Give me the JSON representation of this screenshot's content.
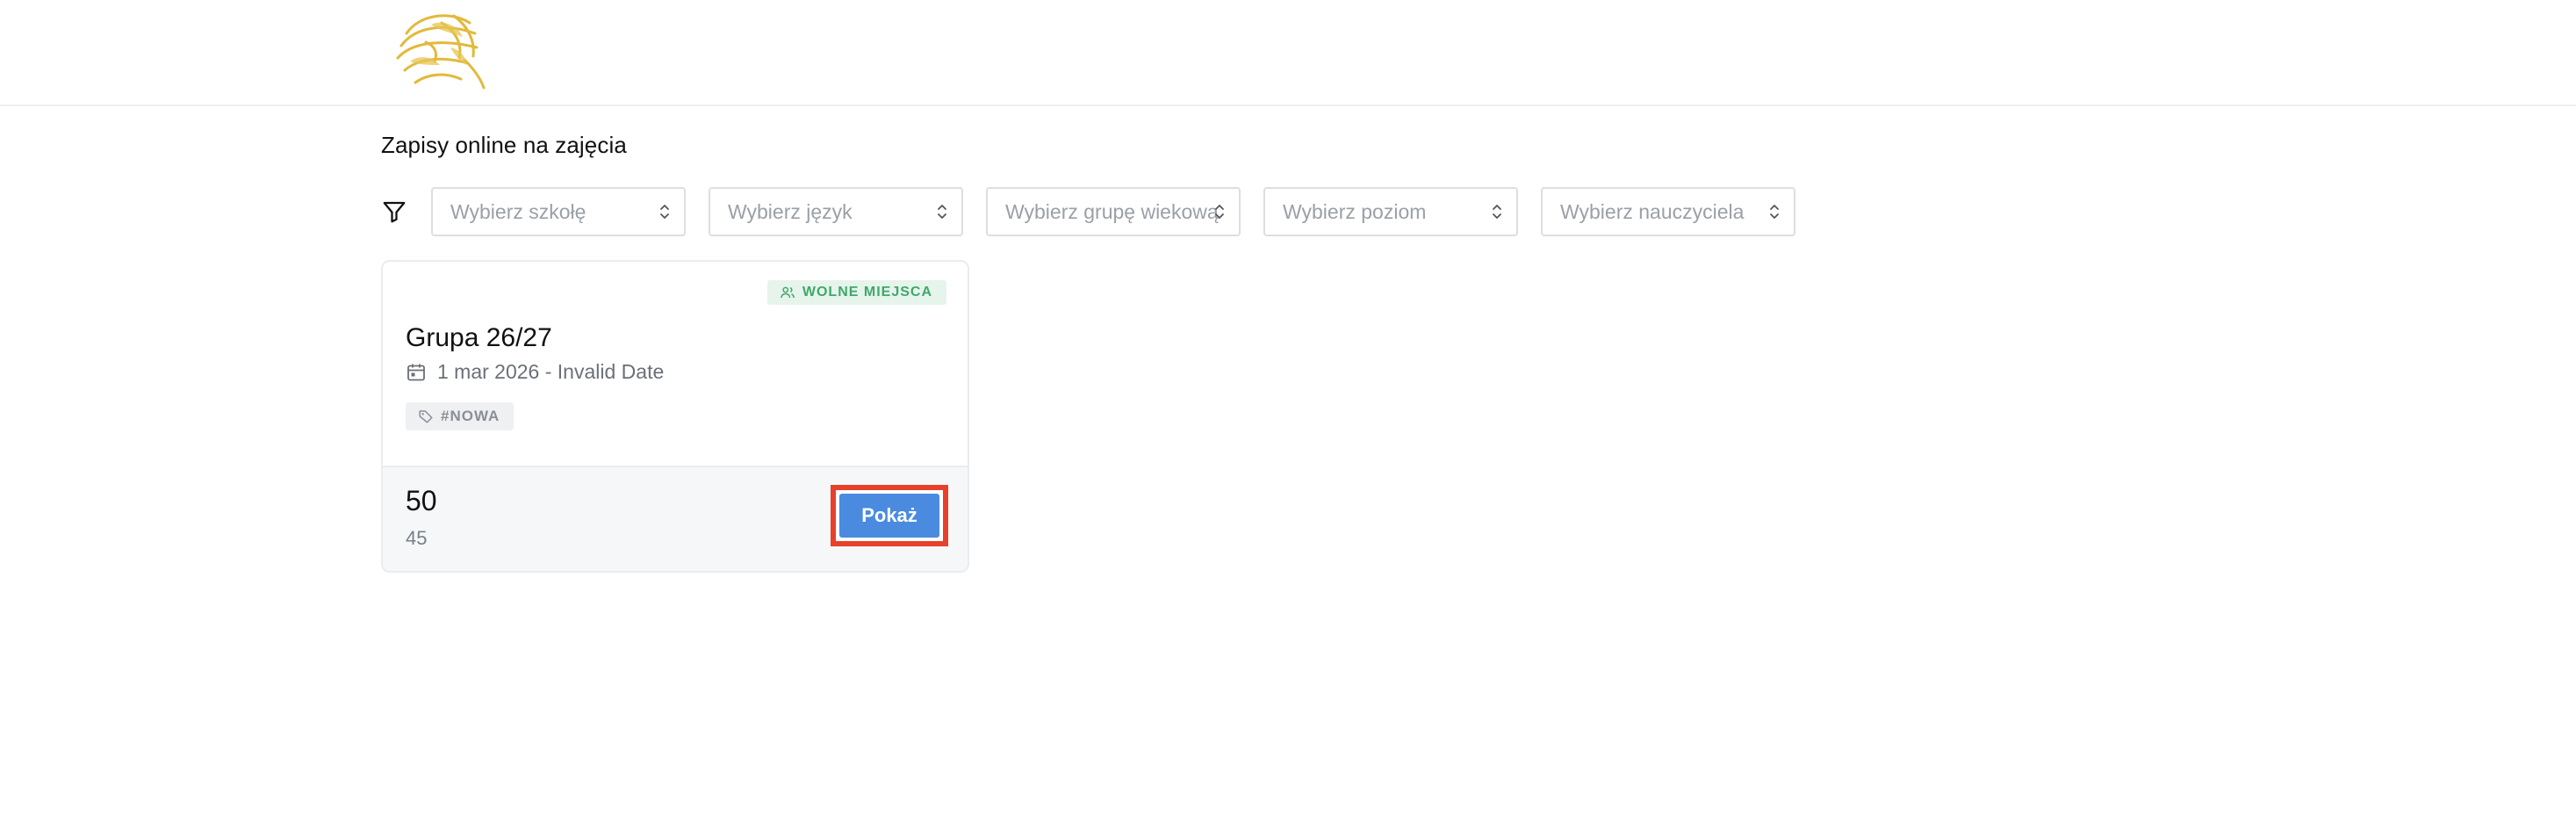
{
  "header": {
    "logo_name": "lion-logo"
  },
  "page": {
    "title": "Zapisy online na zajęcia"
  },
  "filters": {
    "school": {
      "placeholder": "Wybierz szkołę"
    },
    "language": {
      "placeholder": "Wybierz język"
    },
    "age_group": {
      "placeholder": "Wybierz grupę wiekową"
    },
    "level": {
      "placeholder": "Wybierz poziom"
    },
    "teacher": {
      "placeholder": "Wybierz nauczyciela"
    }
  },
  "card": {
    "badge": "WOLNE MIEJSCA",
    "name": "Grupa 26/27",
    "date": "1 mar 2026 - Invalid Date",
    "tag": "#NOWA",
    "price_main": "50",
    "price_sub": "45",
    "button_label": "Pokaż"
  },
  "colors": {
    "accent": "#4a8be0",
    "badge_green": "#3fa86a",
    "highlight": "#e8402a",
    "logo_gold": "#e2b93b"
  }
}
